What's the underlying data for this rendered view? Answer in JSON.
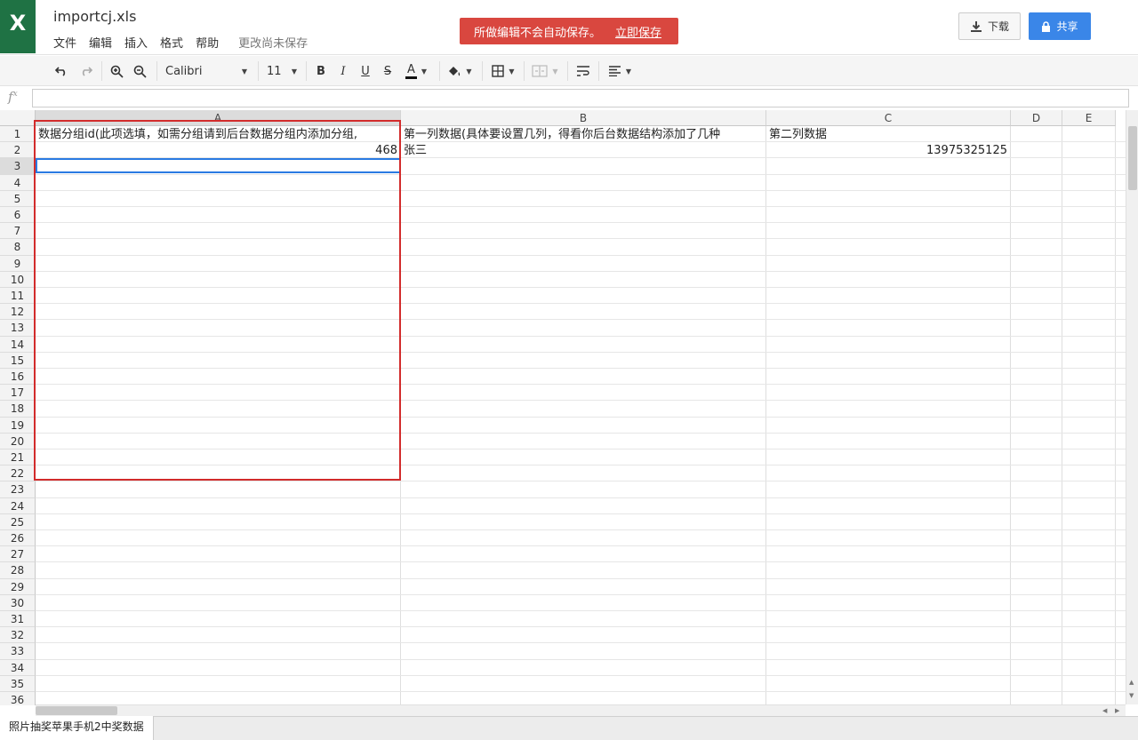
{
  "app": {
    "logo_letter": "X",
    "file_name": "importcj.xls",
    "menu": [
      "文件",
      "编辑",
      "插入",
      "格式",
      "帮助"
    ],
    "save_status": "更改尚未保存",
    "notice": {
      "text": "所做编辑不会自动保存。",
      "action": "立即保存"
    },
    "download_label": "下载",
    "share_label": "共享",
    "colors": {
      "brand": "#1f7244",
      "notice": "#d9473f",
      "share": "#3a86e8",
      "selection": "#2a7ae2",
      "highlight_box": "#d22c2c"
    }
  },
  "toolbar": {
    "font_name": "Calibri",
    "font_size": "11",
    "bold": "B",
    "italic": "I",
    "underline": "U",
    "strike": "S",
    "text_color": "A",
    "icons": [
      "undo-icon",
      "redo-icon",
      "zoom-in-icon",
      "zoom-out-icon",
      "fill-color-icon",
      "borders-icon",
      "merge-icon",
      "wrap-icon",
      "align-icon"
    ]
  },
  "formula_bar": {
    "label": "fx",
    "value": ""
  },
  "sheet": {
    "columns": [
      "A",
      "B",
      "C",
      "D",
      "E"
    ],
    "selected_column": "A",
    "selected_row": 3,
    "rows": [
      "1",
      "2",
      "3",
      "4",
      "5",
      "6",
      "7",
      "8",
      "9",
      "10",
      "11",
      "12",
      "13",
      "14",
      "15",
      "16",
      "17",
      "18",
      "19",
      "20",
      "21",
      "22",
      "23",
      "24",
      "25",
      "26",
      "27",
      "28",
      "29",
      "30",
      "31",
      "32",
      "33",
      "34",
      "35",
      "36"
    ],
    "cells": {
      "A1": "数据分组id(此项选填，如需分组请到后台数据分组内添加分组,",
      "B1": "第一列数据(具体要设置几列，得看你后台数据结构添加了几种",
      "C1": "第二列数据",
      "A2": "468",
      "B2": "张三",
      "C2": "13975325125"
    }
  },
  "sheet_tabs": [
    "照片抽奖苹果手机2中奖数据"
  ]
}
